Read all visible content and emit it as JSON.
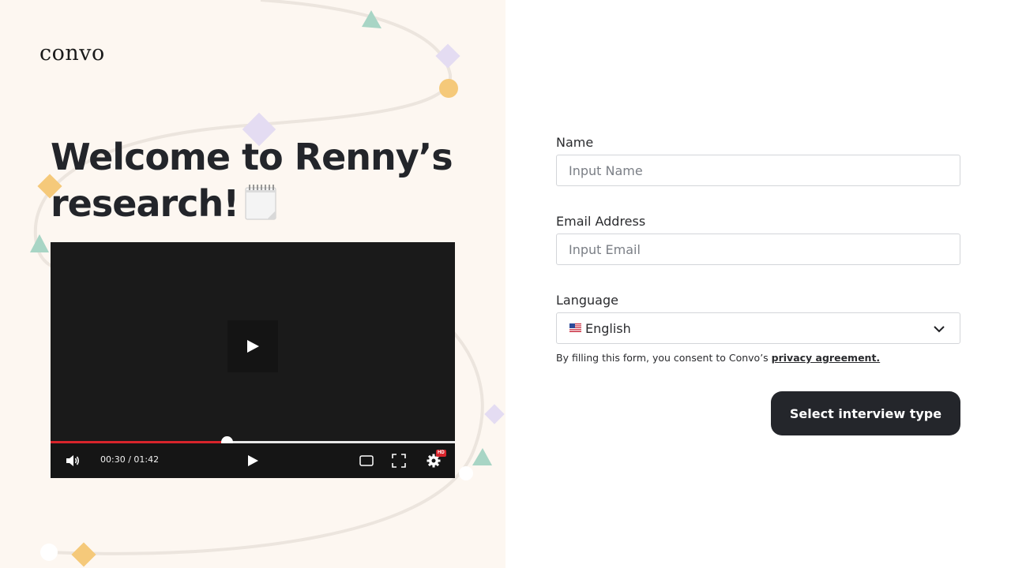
{
  "brand": {
    "logo_text": "convo"
  },
  "hero": {
    "title": "Welcome to Renny’s research!",
    "emoji_icon": "notepad-icon"
  },
  "video": {
    "current_time": "00:30",
    "duration": "01:42",
    "time_display": "00:30 / 01:42",
    "progress_fraction": 0.435,
    "hd_badge": "HD",
    "accent_color": "#d8242b"
  },
  "form": {
    "name": {
      "label": "Name",
      "placeholder": "Input Name",
      "value": ""
    },
    "email": {
      "label": "Email Address",
      "placeholder": "Input Email",
      "value": ""
    },
    "language": {
      "label": "Language",
      "selected": "English",
      "flag_icon": "us-flag-icon"
    },
    "consent": {
      "text": "By filling this form, you consent to Convo’s ",
      "link": "privacy agreement."
    },
    "submit_label": "Select interview type"
  },
  "colors": {
    "left_panel_bg": "#fdf7f1",
    "button_bg": "#24262b",
    "deco_green": "#a8d5c5",
    "deco_lavender": "#e4dcf2",
    "deco_orange": "#f5c97a"
  }
}
